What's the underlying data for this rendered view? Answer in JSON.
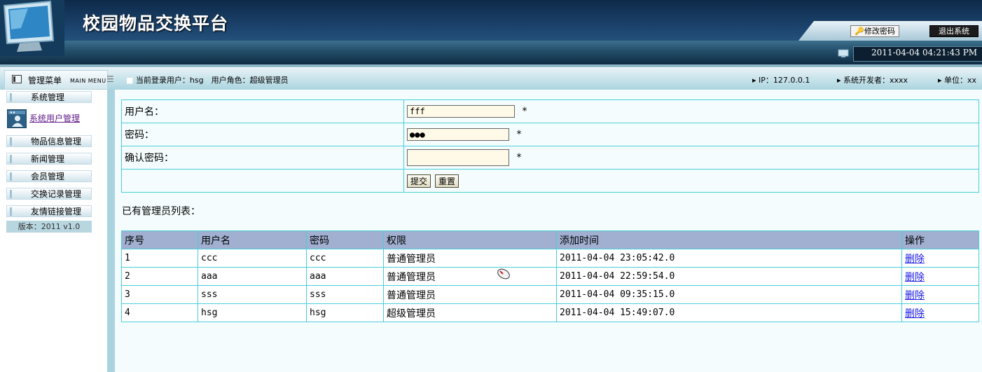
{
  "header": {
    "title": "校园物品交换平台",
    "change_password": "修改密码",
    "logout": "退出系统",
    "clock": "2011-04-04 04:21:43 PM"
  },
  "status": {
    "menu_title": "管理菜单",
    "menu_sub": "MAIN MENU",
    "current_user": "当前登录用户：hsg　用户角色：超级管理员",
    "ip": "IP：127.0.0.1",
    "developer": "系统开发者：xxxx",
    "unit": "单位：xx"
  },
  "sidebar": {
    "items": [
      "系统管理",
      "系统用户管理",
      "物品信息管理",
      "新闻管理",
      "会员管理",
      "交换记录管理",
      "友情链接管理"
    ],
    "version": "版本：2011 v1.0"
  },
  "form": {
    "username_label": "用户名：",
    "username_value": "fff",
    "password_label": "密码：",
    "password_value": "●●●",
    "confirm_label": "确认密码：",
    "confirm_value": "",
    "required": "*",
    "submit": "提交",
    "reset": "重置"
  },
  "list": {
    "title": "已有管理员列表：",
    "headers": [
      "序号",
      "用户名",
      "密码",
      "权限",
      "添加时间",
      "操作"
    ],
    "rows": [
      [
        "1",
        "ccc",
        "ccc",
        "普通管理员",
        "2011-04-04 23:05:42.0",
        "删除"
      ],
      [
        "2",
        "aaa",
        "aaa",
        "普通管理员",
        "2011-04-04 22:59:54.0",
        "删除"
      ],
      [
        "3",
        "sss",
        "sss",
        "普通管理员",
        "2011-04-04 09:35:15.0",
        "删除"
      ],
      [
        "4",
        "hsg",
        "hsg",
        "超级管理员",
        "2011-04-04 15:49:07.0",
        "删除"
      ]
    ]
  },
  "colors": {
    "header_dark": "#0e2a4a",
    "cell_border": "#49cfdc",
    "table_header": "#a1afd1",
    "link": "#1a1ae6"
  }
}
